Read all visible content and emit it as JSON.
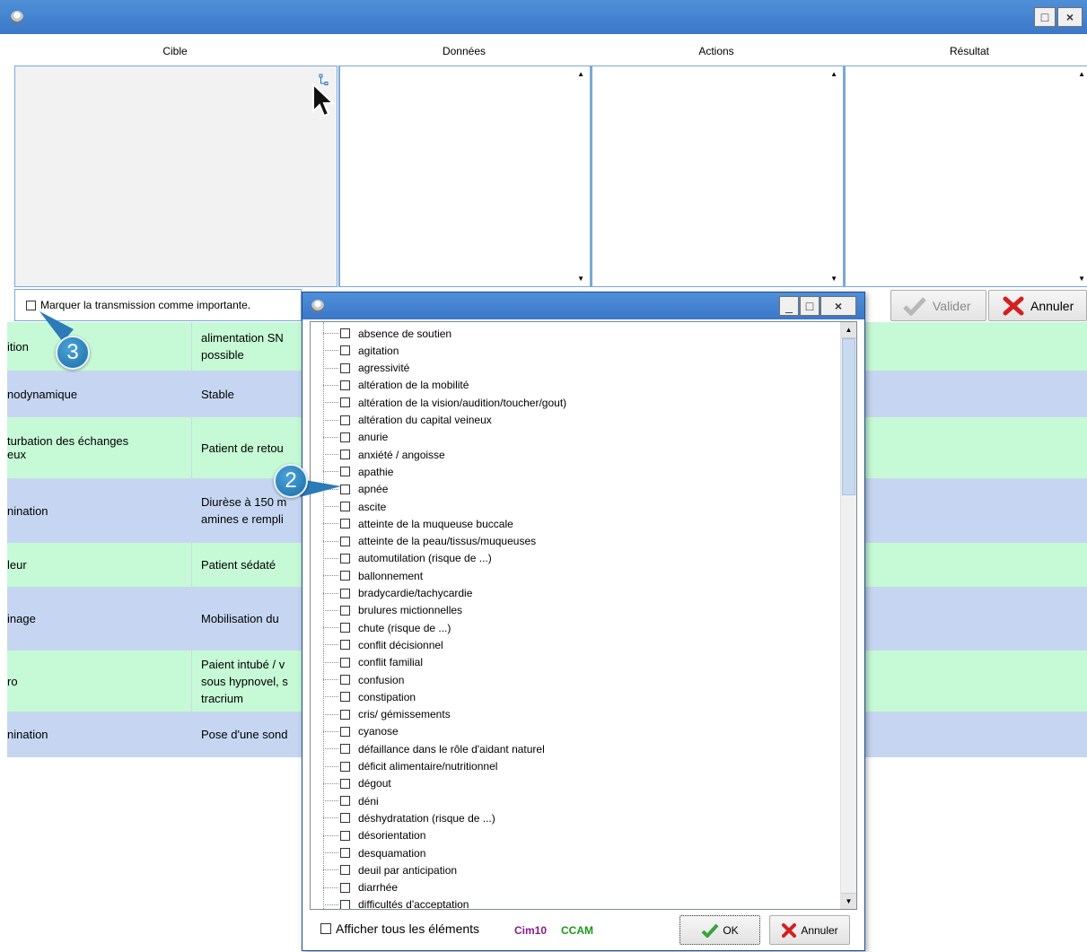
{
  "main": {
    "columns": [
      "Cible",
      "Données",
      "Actions",
      "Résultat"
    ],
    "important_checkbox_label": "Marquer la transmission comme importante.",
    "validate_label": "Valider",
    "cancel_label": "Annuler",
    "window_controls": {
      "maximize": "□",
      "close": "×"
    }
  },
  "grid": {
    "rows": [
      {
        "label": "ition",
        "value": "alimentation SN\npossible",
        "color": "green"
      },
      {
        "label": "nodynamique",
        "value": "Stable",
        "color": "blue"
      },
      {
        "label": "turbation des échanges\neux",
        "value": "Patient de retou",
        "color": "green"
      },
      {
        "label": "nination",
        "value": "Diurèse à 150 m\namines e rempli",
        "color": "blue"
      },
      {
        "label": "leur",
        "value": "Patient sédaté",
        "color": "green"
      },
      {
        "label": "inage",
        "value": "Mobilisation du",
        "color": "blue"
      },
      {
        "label": "ro",
        "value": "Paient intubé / v\nsous hypnovel, s\ntracrium",
        "color": "green"
      },
      {
        "label": "nination",
        "value": "Pose d'une sond",
        "color": "blue"
      }
    ]
  },
  "badges": {
    "b2": "2",
    "b3": "3"
  },
  "dialog": {
    "window_controls": {
      "minimize": "_",
      "maximize": "□",
      "close": "×"
    },
    "items": [
      "absence de soutien",
      "agitation",
      "agressivité",
      "altération de la mobilité",
      "altération de la vision/audition/toucher/gout)",
      "altération du capital veineux",
      "anurie",
      "anxiété / angoisse",
      "apathie",
      "apnée",
      "ascite",
      "atteinte de la muqueuse buccale",
      "atteinte de la peau/tissus/muqueuses",
      "automutilation (risque de ...)",
      "ballonnement",
      "bradycardie/tachycardie",
      "brulures mictionnelles",
      "chute (risque de ...)",
      "conflit décisionnel",
      "conflit familial",
      "confusion",
      "constipation",
      "cris/ gémissements",
      "cyanose",
      "défaillance dans le rôle d'aidant naturel",
      "déficit alimentaire/nutritionnel",
      "dégout",
      "déni",
      "déshydratation (risque de ...)",
      "désorientation",
      "desquamation",
      "deuil par anticipation",
      "diarrhée",
      "difficultés d'acceptation"
    ],
    "show_all_label": "Afficher tous les éléments",
    "cim10_label": "Cim10",
    "ccam_label": "CCAM",
    "ok_label": "OK",
    "cancel_label": "Annuler"
  },
  "colors": {
    "titlebar": "#3b78c8",
    "row_green": "#c6f9d6",
    "row_blue": "#c6d6f2",
    "cim10": "#8b1a8b",
    "ccam": "#1a9a1a",
    "cancel_x": "#d32020",
    "ok_check": "#3aa33a"
  }
}
